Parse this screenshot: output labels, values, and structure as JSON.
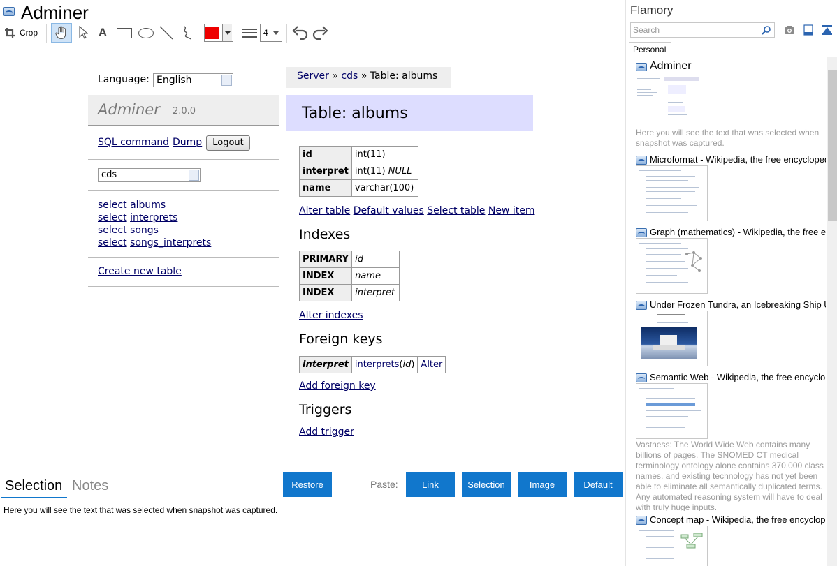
{
  "window": {
    "title": "Adminer"
  },
  "toolbar": {
    "crop_label": "Crop",
    "line_width": "4",
    "color": "#ee0000",
    "tools": [
      "crop-icon",
      "hand-icon",
      "pointer-icon",
      "text-icon",
      "rectangle-icon",
      "ellipse-icon",
      "line-icon",
      "freehand-icon",
      "color-picker",
      "line-weight-icon",
      "undo-icon",
      "redo-icon"
    ]
  },
  "adminer": {
    "language_label": "Language:",
    "language_value": "English",
    "brand": "Adminer",
    "version": "2.0.0",
    "sql_command": "SQL command",
    "dump": "Dump",
    "logout": "Logout",
    "db_value": "cds",
    "select_word": "select",
    "tables": [
      "albums",
      "interprets",
      "songs",
      "songs_interprets"
    ],
    "create_table": "Create new table",
    "breadcrumb": {
      "server": "Server",
      "sep": "»",
      "db": "cds",
      "current": "Table: albums"
    },
    "page_title": "Table: albums",
    "columns": [
      {
        "name": "id",
        "type": "int(11)",
        "extra": ""
      },
      {
        "name": "interpret",
        "type": "int(11)",
        "extra": "NULL"
      },
      {
        "name": "name",
        "type": "varchar(100)",
        "extra": ""
      }
    ],
    "table_links": [
      "Alter table",
      "Default values",
      "Select table",
      "New item"
    ],
    "indexes_heading": "Indexes",
    "indexes": [
      {
        "type": "PRIMARY",
        "cols": "id"
      },
      {
        "type": "INDEX",
        "cols": "name"
      },
      {
        "type": "INDEX",
        "cols": "interpret"
      }
    ],
    "alter_indexes": "Alter indexes",
    "fk_heading": "Foreign keys",
    "fk": {
      "column": "interpret",
      "target_table": "interprets",
      "target_col": "id",
      "alter": "Alter"
    },
    "add_fk": "Add foreign key",
    "triggers_heading": "Triggers",
    "add_trigger": "Add trigger"
  },
  "bottom": {
    "tabs": [
      "Selection",
      "Notes"
    ],
    "restore": "Restore",
    "paste_label": "Paste:",
    "paste_buttons": [
      "Link",
      "Selection",
      "Image",
      "Default"
    ],
    "selection_text": "Here you will see the text that was selected when snapshot was captured."
  },
  "flamory": {
    "app_name": "Flamory",
    "search_placeholder": "Search",
    "tab": "Personal",
    "snapshots": [
      {
        "title": "Adminer",
        "note": "Here you will see the text that was selected when snapshot was captured."
      },
      {
        "title": "Microformat - Wikipedia, the free encyclopedia"
      },
      {
        "title": "Graph (mathematics) - Wikipedia, the free encyclopedia"
      },
      {
        "title": "Under Frozen Tundra, an Icebreaking Ship Uncovers..."
      },
      {
        "title": "Semantic Web - Wikipedia, the free encyclopedia",
        "note": "Vastness: The World Wide Web contains many billions of pages. The SNOMED CT medical terminology ontology alone contains 370,000 class names, and existing technology has not yet been able to eliminate all semantically duplicated terms. Any automated reasoning system will have to deal with truly huge inputs."
      },
      {
        "title": "Concept map - Wikipedia, the free encyclopedia"
      }
    ]
  },
  "colors": {
    "accent": "#1177cc",
    "title_band": "#ddddff",
    "adminer_link": "#000066"
  }
}
